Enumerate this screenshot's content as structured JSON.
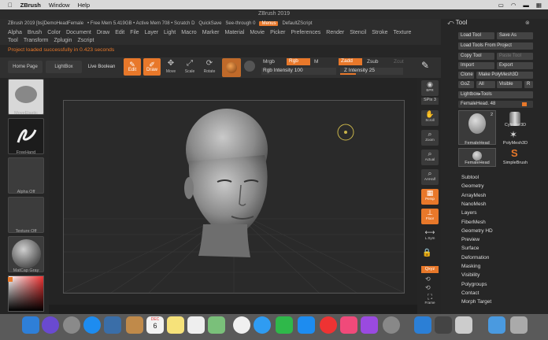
{
  "mac_menu": {
    "app": "ZBrush",
    "items": [
      "Window",
      "Help"
    ]
  },
  "title": "ZBrush 2019",
  "info_bar": {
    "file": "ZBrush 2019 [bs]DemoHeadFemale",
    "mem": "• Free Mem 5.419GB • Active Mem 708 • Scratch D",
    "quicksave": "QuickSave",
    "seethrough": "See-through  0",
    "menus": "Menus",
    "script": "DefaultZScript"
  },
  "menu_line1": [
    "Alpha",
    "Brush",
    "Color",
    "Document",
    "Draw",
    "Edit",
    "File",
    "Layer",
    "Light",
    "Macro",
    "Marker",
    "Material",
    "Movie",
    "Picker",
    "Preferences",
    "Render",
    "Stencil",
    "Stroke",
    "Texture"
  ],
  "menu_line2": [
    "Tool",
    "Transform",
    "Zplugin",
    "Zscript"
  ],
  "status": "Project loaded successfully in 0.423 seconds",
  "toolbar": {
    "home": "Home Page",
    "lightbox": "LightBox",
    "live_boolean": "Live Boolean",
    "edit": "Edit",
    "draw": "Draw",
    "move": "Move",
    "scale": "Scale",
    "rotate": "Rotate",
    "mrgb": "Mrgb",
    "rgb": "Rgb",
    "m": "M",
    "zadd": "Zadd",
    "zsub": "Zsub",
    "zcut": "Zcut",
    "rgb_intensity": "Rgb Intensity 100",
    "z_intensity": "Z Intensity 25"
  },
  "left_shelf": {
    "brush": "MoveElastic",
    "stroke": "FreeHand",
    "alpha": "Alpha Off",
    "texture": "Texture Off",
    "material": "MatCap Gray"
  },
  "right_shelf": [
    "BPR",
    "SPix 3",
    "Scroll",
    "Zoom",
    "Actual",
    "AAHalf",
    "Persp",
    "Floor",
    "L.Sym",
    "Qxyz",
    "Frame"
  ],
  "tool_panel": {
    "title": "Tool",
    "buttons": [
      "Load Tool",
      "Save As",
      "Load Tools From Project",
      "Copy Tool",
      "Paste Tool",
      "Import",
      "Export",
      "Clone",
      "Make PolyMesh3D",
      "GoZ",
      "All",
      "Visible",
      "R",
      "Lightbox▸Tools"
    ],
    "female_head_label": "FemaleHead. 48",
    "thumbs": [
      "FemaleHead",
      "Cylinder3D",
      "PolyMesh3D",
      "FemaleHead",
      "SimpleBrush"
    ],
    "thumb_count": "2",
    "submenus": [
      "Subtool",
      "Geometry",
      "ArrayMesh",
      "NanoMesh",
      "Layers",
      "FiberMesh",
      "Geometry HD",
      "Preview",
      "Surface",
      "Deformation",
      "Masking",
      "Visibility",
      "Polygroups",
      "Contact",
      "Morph Target"
    ]
  },
  "calendar": {
    "month": "DEC",
    "day": "6"
  },
  "colors": {
    "accent": "#e8782a",
    "bg": "#1e1e1e"
  }
}
